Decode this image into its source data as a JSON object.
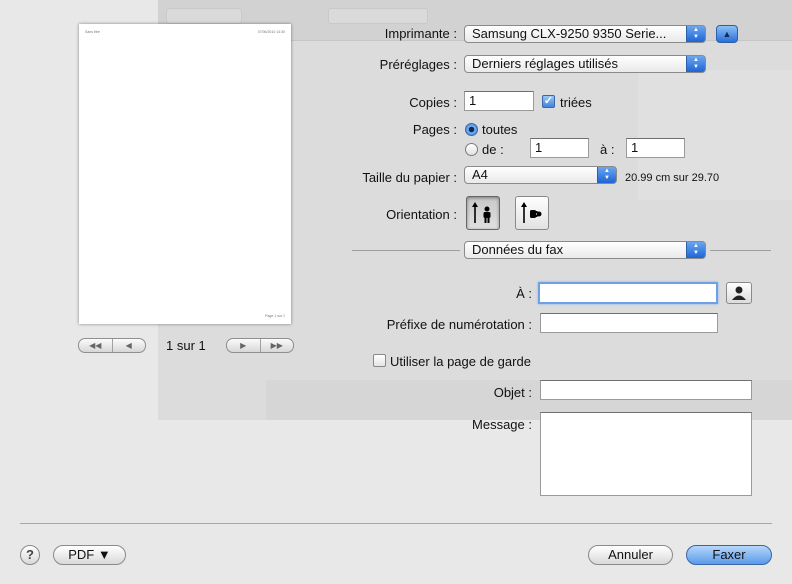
{
  "preview": {
    "header_left": "Sans titre",
    "header_right": "07/06/2010 14:30",
    "footer": "Page 1 sur 1",
    "page_indicator": "1 sur 1"
  },
  "printer": {
    "label": "Imprimante :",
    "value": "Samsung CLX-9250 9350 Serie..."
  },
  "presets": {
    "label": "Préréglages :",
    "value": "Derniers réglages utilisés"
  },
  "copies": {
    "label": "Copies :",
    "value": "1",
    "collated_label": "triées",
    "collated": true
  },
  "pages": {
    "label": "Pages :",
    "all_label": "toutes",
    "from_label": "de :",
    "from_value": "1",
    "to_label": "à :",
    "to_value": "1"
  },
  "paper_size": {
    "label": "Taille du papier :",
    "value": "A4",
    "dimensions": "20.99 cm sur 29.70"
  },
  "orientation": {
    "label": "Orientation :"
  },
  "section_popup": "Données du fax",
  "fax": {
    "to_label": "À :",
    "to_value": "",
    "prefix_label": "Préfixe de numérotation :",
    "prefix_value": "",
    "cover_label": "Utiliser la page de garde",
    "subject_label": "Objet :",
    "subject_value": "",
    "message_label": "Message :",
    "message_value": ""
  },
  "footer": {
    "help": "?",
    "pdf": "PDF ▼",
    "cancel": "Annuler",
    "fax": "Faxer"
  },
  "colors": {
    "accent": "#3f7fd8",
    "sheet_bg": "#e8e8e8"
  }
}
